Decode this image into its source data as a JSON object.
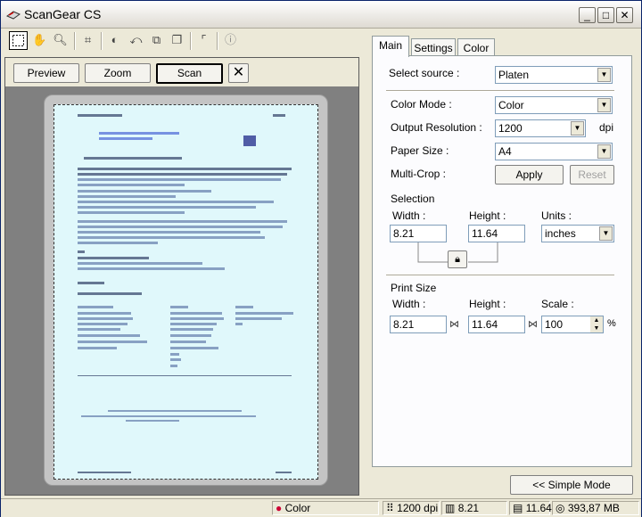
{
  "window": {
    "title": "ScanGear CS",
    "min_label": "_",
    "max_label": "□",
    "close_label": "✕"
  },
  "toolbar": {
    "icons": [
      "crop-selection-icon",
      "hand-icon",
      "zoom-icon",
      "auto-crop-icon",
      "invert-icon",
      "rotate-icon",
      "mirror-icon",
      "copy-icon",
      "frame-icon",
      "info-icon"
    ]
  },
  "preview_controls": {
    "preview_label": "Preview",
    "zoom_label": "Zoom",
    "scan_label": "Scan",
    "clear_label": "✕"
  },
  "tabs": [
    {
      "label": "Main"
    },
    {
      "label": "Settings"
    },
    {
      "label": "Color"
    }
  ],
  "main": {
    "select_source_label": "Select source :",
    "select_source_value": "Platen",
    "color_mode_label": "Color Mode :",
    "color_mode_value": "Color",
    "output_resolution_label": "Output Resolution :",
    "output_resolution_value": "1200",
    "output_resolution_unit": "dpi",
    "paper_size_label": "Paper Size :",
    "paper_size_value": "A4",
    "multicrop_label": "Multi-Crop :",
    "apply_label": "Apply",
    "reset_label": "Reset",
    "selection_heading": "Selection",
    "width_label": "Width :",
    "height_label": "Height :",
    "units_label": "Units :",
    "sel_width": "8.21",
    "sel_height": "11.64",
    "units_value": "inches",
    "print_size_heading": "Print Size",
    "print_width_label": "Width :",
    "print_height_label": "Height :",
    "scale_label": "Scale :",
    "print_width": "8.21",
    "print_height": "11.64",
    "scale_value": "100",
    "scale_unit": "%"
  },
  "simple_mode_label": "<< Simple Mode",
  "status": {
    "color": "Color",
    "resolution": "1200 dpi",
    "width": "8.21",
    "height": "11.64",
    "memory": "393,87 MB"
  }
}
